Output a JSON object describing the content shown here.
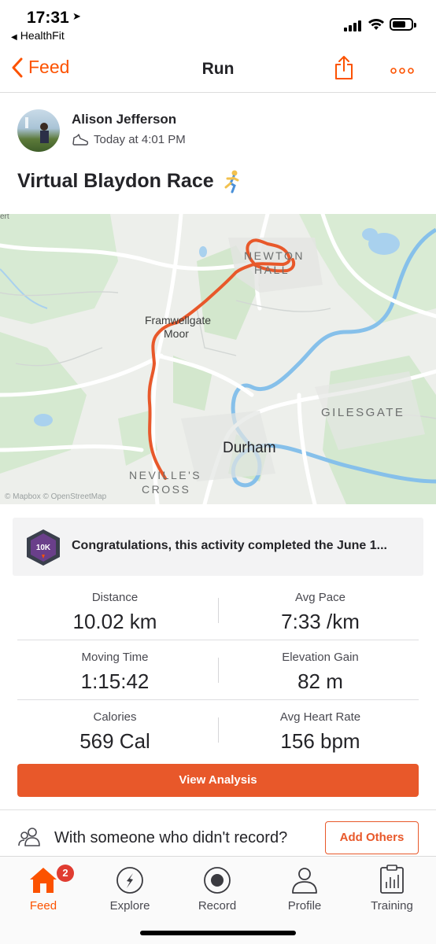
{
  "status_bar": {
    "time": "17:31",
    "back_app": "HealthFit"
  },
  "nav": {
    "back_label": "Feed",
    "title": "Run"
  },
  "athlete": {
    "name": "Alison Jefferson",
    "timestamp": "Today at 4:01 PM"
  },
  "activity": {
    "title": "Virtual Blaydon Race",
    "emoji": "🏃"
  },
  "map": {
    "labels": {
      "newton_hall_1": "NEWTON",
      "newton_hall_2": "HALL",
      "framwellgate_1": "Framwellgate",
      "framwellgate_2": "Moor",
      "gilesgate": "GILESGATE",
      "durham": "Durham",
      "nevilles_1": "NEVILLE'S",
      "nevilles_2": "CROSS",
      "edge_label": "ert"
    },
    "attribution": "© Mapbox © OpenStreetMap",
    "route_color": "#e8582a",
    "river_color": "#7ab8e6"
  },
  "challenge": {
    "text": "Congratulations, this activity completed the June 1...",
    "badge_text": "10K"
  },
  "stats": [
    {
      "label": "Distance",
      "value": "10.02 km"
    },
    {
      "label": "Avg Pace",
      "value": "7:33 /km"
    },
    {
      "label": "Moving Time",
      "value": "1:15:42"
    },
    {
      "label": "Elevation Gain",
      "value": "82 m"
    },
    {
      "label": "Calories",
      "value": "569 Cal"
    },
    {
      "label": "Avg Heart Rate",
      "value": "156 bpm"
    }
  ],
  "view_analysis_label": "View Analysis",
  "add_others": {
    "prompt": "With someone who didn't record?",
    "button_label": "Add Others"
  },
  "tabs": [
    {
      "label": "Feed",
      "badge": "2"
    },
    {
      "label": "Explore"
    },
    {
      "label": "Record"
    },
    {
      "label": "Profile"
    },
    {
      "label": "Training"
    }
  ],
  "colors": {
    "accent": "#fc5200",
    "button": "#e8582a",
    "badge": "#e03c31"
  }
}
